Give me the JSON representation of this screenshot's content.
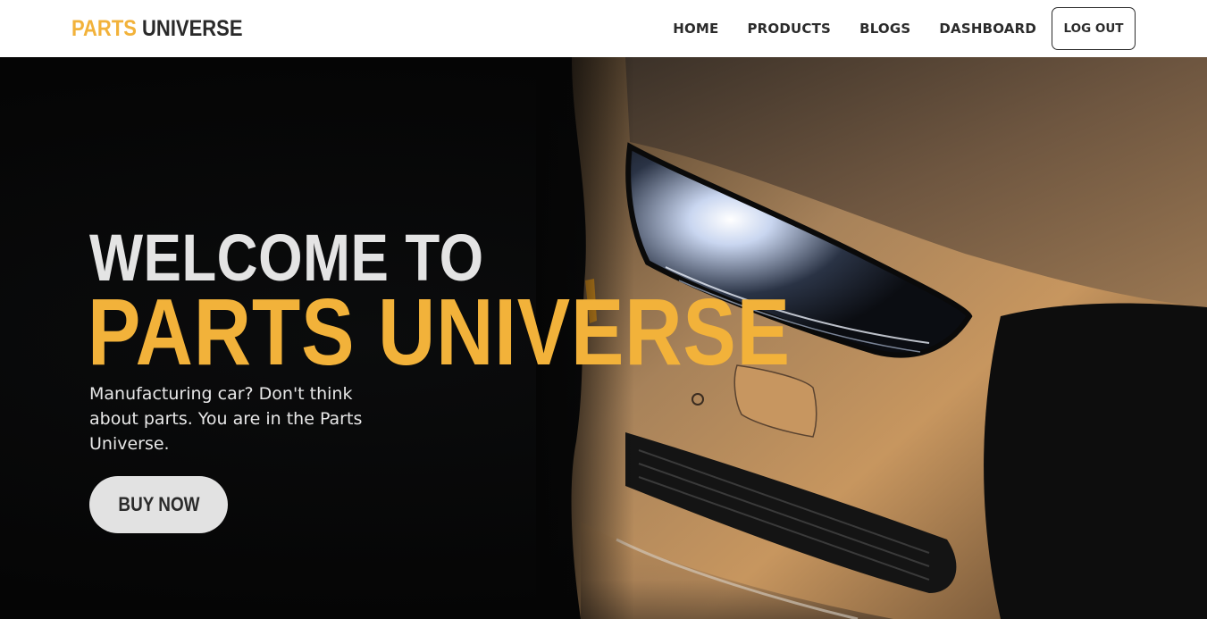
{
  "brand": {
    "part1": "PARTS",
    "part2": "UNIVERSE"
  },
  "nav": {
    "home": "HOME",
    "products": "PRODUCTS",
    "blogs": "BLOGS",
    "dashboard": "DASHBOARD",
    "logout": "LOG OUT"
  },
  "hero": {
    "welcome": "WELCOME TO",
    "title": "PARTS UNIVERSE",
    "subtitle": "Manufacturing car? Don't think about parts. You are in the Parts Universe.",
    "cta": "BUY NOW"
  },
  "colors": {
    "accent": "#f2b23a",
    "navbar_bg": "#ffffff",
    "hero_bg": "#050505",
    "button_bg": "#e2e2e2"
  }
}
